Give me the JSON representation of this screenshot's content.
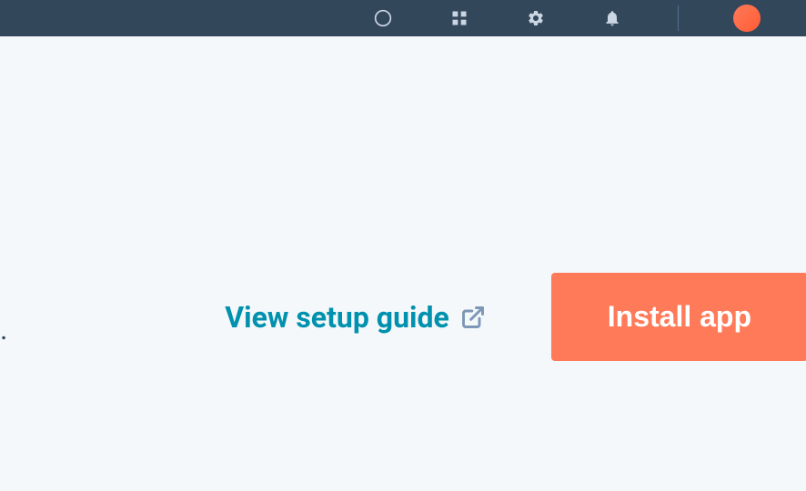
{
  "actions": {
    "setup_guide_label": "View setup guide",
    "install_label": "Install app"
  },
  "fragment": {
    "trailing_dot": "."
  },
  "colors": {
    "nav_bg": "#33475b",
    "page_bg": "#f5f8fa",
    "link": "#0091ae",
    "button_bg": "#ff7a59",
    "button_text": "#ffffff"
  }
}
